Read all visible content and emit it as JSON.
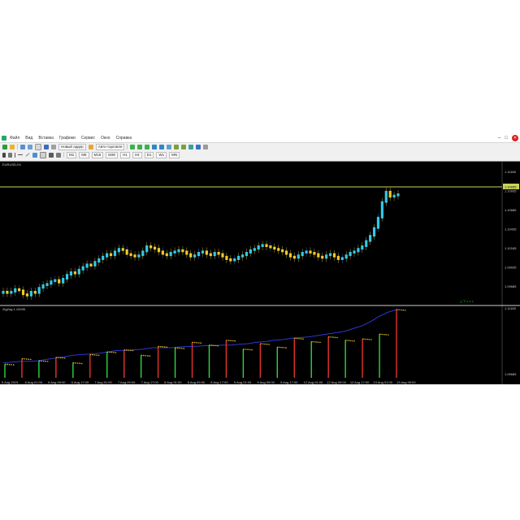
{
  "window": {
    "menu": [
      "Файл",
      "Вид",
      "Вставка",
      "Графики",
      "Сервис",
      "Окно",
      "Справка"
    ]
  },
  "toolbar1": {
    "new_order": "Новый ордер",
    "auto_trading": "Авто-торговля"
  },
  "toolbar2": {
    "buttons": [
      "M1",
      "M5",
      "M15",
      "M30",
      "H1",
      "H4",
      "D1",
      "W1",
      "MN"
    ]
  },
  "chart": {
    "symbol_label": "EURUSD,H1",
    "price_levels": [
      "1.11185",
      "1.10935",
      "1.10685",
      "1.10435",
      "1.10185",
      "1.09935",
      "1.09685"
    ],
    "current_price": "1.10935",
    "horizontal_line_color": "#c8d45a",
    "bull_color": "#32c8e6",
    "bear_color": "#f0c828",
    "corner_marker": "△ ▽ ▵ ▿ ▵",
    "candles": [
      35,
      34,
      35,
      37,
      36,
      33,
      32,
      35,
      34,
      38,
      40,
      41,
      43,
      44,
      42,
      45,
      48,
      50,
      49,
      52,
      54,
      56,
      55,
      58,
      60,
      62,
      64,
      63,
      66,
      68,
      67,
      64,
      63,
      62,
      63,
      66,
      70,
      69,
      68,
      66,
      64,
      63,
      65,
      66,
      67,
      66,
      64,
      62,
      63,
      65,
      66,
      64,
      63,
      65,
      64,
      62,
      60,
      59,
      60,
      62,
      63,
      65,
      67,
      68,
      70,
      71,
      70,
      69,
      68,
      67,
      66,
      64,
      62,
      61,
      63,
      65,
      66,
      65,
      64,
      62,
      61,
      63,
      64,
      62,
      60,
      61,
      63,
      65,
      66,
      68,
      70,
      74,
      78,
      84,
      92,
      104,
      112,
      108,
      109,
      110
    ]
  },
  "indicator": {
    "label": "ZigZag 1.10935",
    "level_top": "1.11185",
    "level_bottom": "1.09685",
    "line_values": [
      0.22,
      0.23,
      0.24,
      0.24,
      0.25,
      0.27,
      0.29,
      0.31,
      0.33,
      0.34,
      0.35,
      0.36,
      0.38,
      0.4,
      0.4,
      0.41,
      0.42,
      0.44,
      0.44,
      0.44,
      0.45,
      0.46,
      0.46,
      0.47,
      0.47,
      0.48,
      0.48,
      0.49,
      0.5,
      0.52,
      0.53,
      0.55,
      0.56,
      0.58,
      0.59,
      0.6,
      0.62,
      0.64,
      0.66,
      0.68,
      0.72,
      0.76,
      0.82,
      0.9,
      0.96,
      1.0
    ],
    "bars": [
      {
        "h": 0.2,
        "c": "#2cd83a"
      },
      {
        "h": 0.28,
        "c": "#e8332a"
      },
      {
        "h": 0.25,
        "c": "#2cd83a"
      },
      {
        "h": 0.3,
        "c": "#e8332a"
      },
      {
        "h": 0.22,
        "c": "#2cd83a"
      },
      {
        "h": 0.34,
        "c": "#e8332a"
      },
      {
        "h": 0.38,
        "c": "#2cd83a"
      },
      {
        "h": 0.41,
        "c": "#e8332a"
      },
      {
        "h": 0.33,
        "c": "#2cd83a"
      },
      {
        "h": 0.46,
        "c": "#e8332a"
      },
      {
        "h": 0.44,
        "c": "#2cd83a"
      },
      {
        "h": 0.52,
        "c": "#e8332a"
      },
      {
        "h": 0.48,
        "c": "#2cd83a"
      },
      {
        "h": 0.55,
        "c": "#e8332a"
      },
      {
        "h": 0.42,
        "c": "#2cd83a"
      },
      {
        "h": 0.5,
        "c": "#e8332a"
      },
      {
        "h": 0.45,
        "c": "#2cd83a"
      },
      {
        "h": 0.58,
        "c": "#e8332a"
      },
      {
        "h": 0.53,
        "c": "#2cd83a"
      },
      {
        "h": 0.6,
        "c": "#e8332a"
      },
      {
        "h": 0.55,
        "c": "#2cd83a"
      },
      {
        "h": 0.57,
        "c": "#e8332a"
      },
      {
        "h": 0.64,
        "c": "#2cd83a"
      },
      {
        "h": 1.0,
        "c": "#e8332a"
      }
    ],
    "x_labels": [
      "5 Aug 2019",
      "6 Aug 01:00",
      "6 Aug 09:00",
      "6 Aug 17:00",
      "7 Aug 01:00",
      "7 Aug 09:00",
      "7 Aug 17:00",
      "8 Aug 01:00",
      "8 Aug 09:00",
      "8 Aug 17:00",
      "9 Aug 01:00",
      "9 Aug 09:00",
      "9 Aug 17:00",
      "12 Aug 01:00",
      "12 Aug 09:00",
      "12 Aug 17:00",
      "13 Aug 01:00",
      "13 Aug 09:00"
    ]
  }
}
